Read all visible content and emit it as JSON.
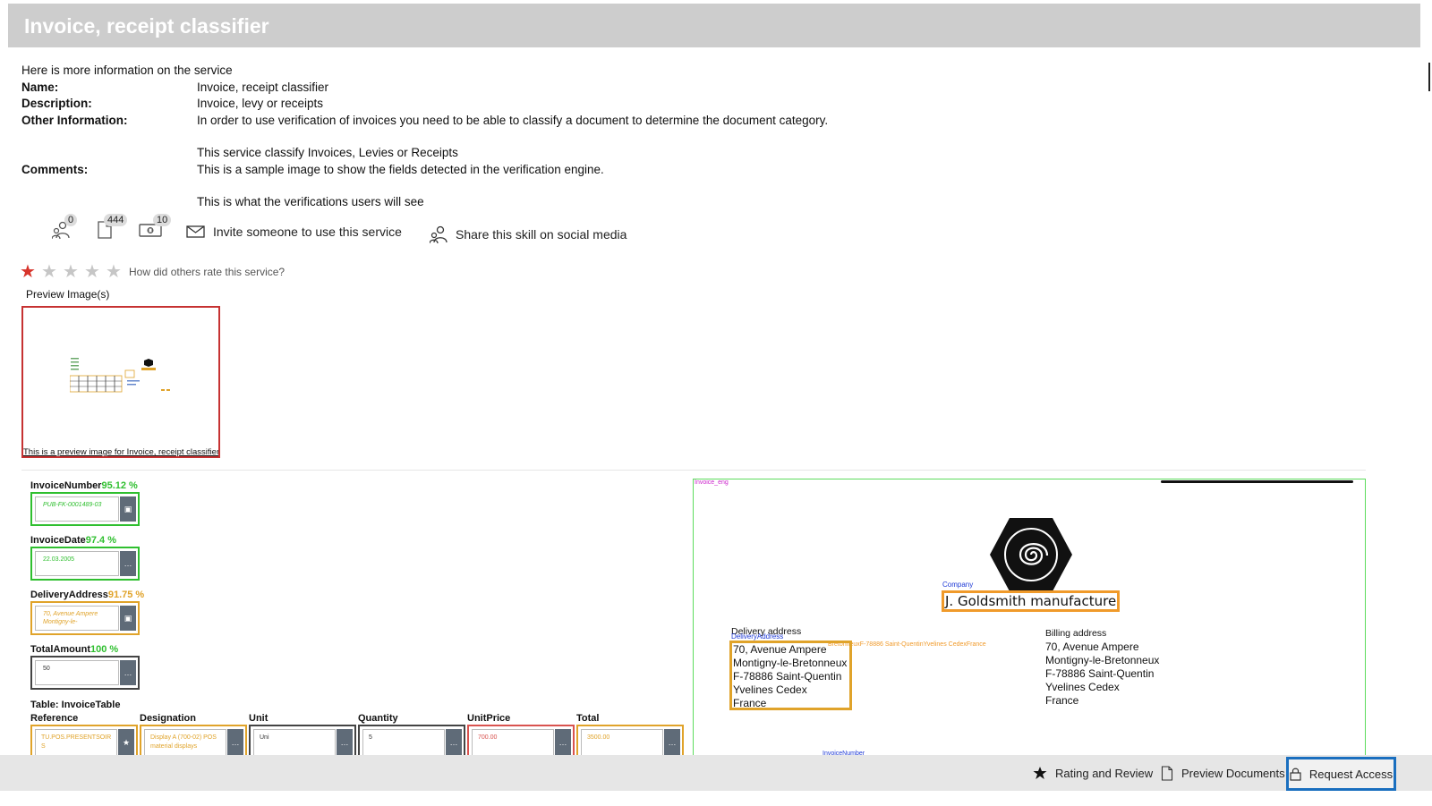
{
  "title": "Invoice, receipt classifier",
  "info": {
    "intro": "Here is more information on the service",
    "name_label": "Name:",
    "name_value": "Invoice, receipt classifier",
    "description_label": "Description:",
    "description_value": "Invoice, levy or receipts",
    "other_label": "Other Information:",
    "other_value_1": "In order to use verification of invoices you need to be able to classify a document to determine the document category.",
    "other_value_2": "This service classify Invoices, Levies or Receipts",
    "comments_label": "Comments:",
    "comments_value_1": "This is a sample image to show the fields detected in the verification engine.",
    "comments_value_2": "This is what the verifications users will see"
  },
  "stats": {
    "users_count": "0",
    "documents_count": "444",
    "cost_count": "10"
  },
  "actions": {
    "invite": "Invite someone to use this service",
    "share": "Share this skill on social media"
  },
  "rating": {
    "value": 1,
    "max": 5,
    "question": "How did others rate this service?"
  },
  "preview": {
    "label": "Preview Image(s)",
    "caption": "This is a preview image for Invoice, receipt classifier"
  },
  "fields": [
    {
      "name": "InvoiceNumber",
      "confidence": "95.12 %",
      "value": "PUB-FK-0001489-03",
      "color": "#2fbf2f"
    },
    {
      "name": "InvoiceDate",
      "confidence": "97.4 %",
      "value": "22.03.2005",
      "color": "#2fbf2f"
    },
    {
      "name": "DeliveryAddress",
      "confidence": "91.75 %",
      "value": "70, Avenue Ampere Montigny-le-",
      "color": "#e0a32a"
    },
    {
      "name": "TotalAmount",
      "confidence": "100 %",
      "value": "50",
      "color": "#2fbf2f"
    }
  ],
  "table": {
    "label": "Table: InvoiceTable",
    "columns": [
      "Reference",
      "Designation",
      "Unit",
      "Quantity",
      "UnitPrice",
      "Total"
    ],
    "row": [
      "TU.POS.PRESENTSOIR S",
      "Display A (700-02) POS material displays",
      "Uni",
      "5",
      "700.00",
      "3500.00"
    ],
    "colors": [
      "#e0a32a",
      "#e0a32a",
      "#444444",
      "#444444",
      "#d9534f",
      "#e0a32a"
    ]
  },
  "document": {
    "tag": "Invoice_eng",
    "company_tag": "Company",
    "company": "J. Goldsmith manufacture",
    "delivery_label": "Delivery address",
    "delivery_tag": "DeliveryAddress",
    "delivery_stream": "BretonneuxF-78886 Saint-QuentinYvelines CedexFrance",
    "delivery_lines": [
      "70, Avenue Ampere",
      "Montigny-le-Bretonneux",
      "F-78886 Saint-Quentin",
      "Yvelines Cedex",
      "France"
    ],
    "billing_label": "Billing address",
    "billing_lines": [
      "70, Avenue Ampere",
      "Montigny-le-Bretonneux",
      "F-78886 Saint-Quentin",
      "Yvelines Cedex",
      "France"
    ],
    "invoice_number_tag": "InvoiceNumber"
  },
  "bottom_bar": {
    "rating": "Rating and Review",
    "preview": "Preview Documents",
    "access": "Request Access"
  }
}
